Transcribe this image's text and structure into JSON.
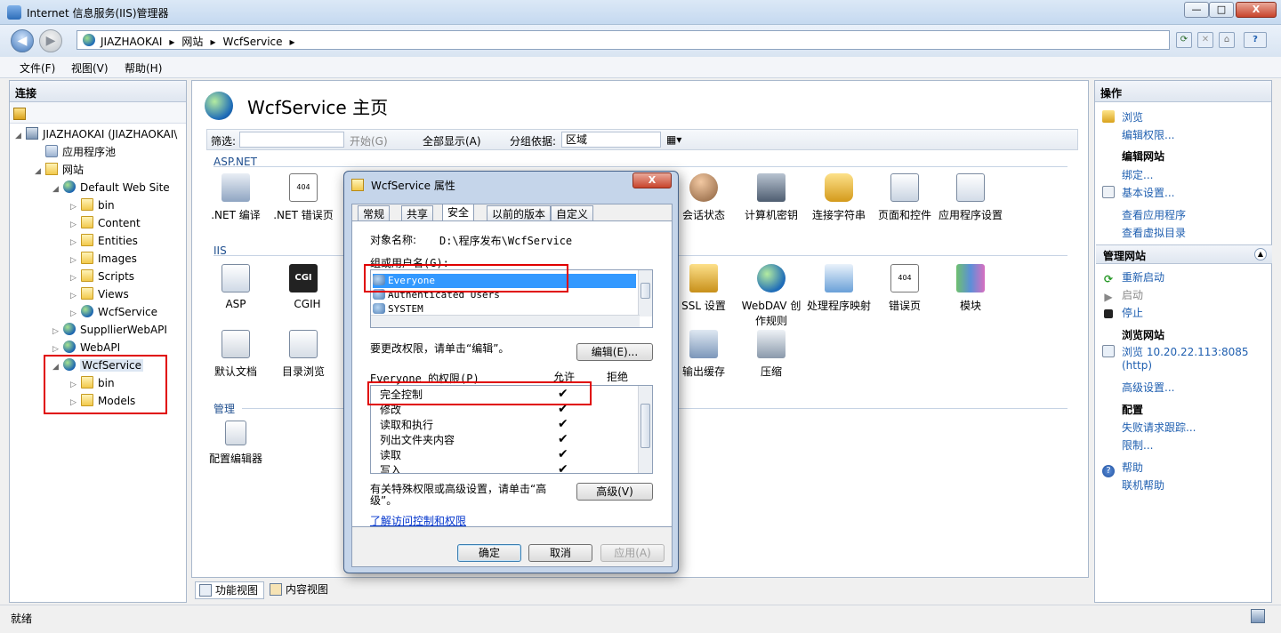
{
  "window": {
    "title": "Internet 信息服务(IIS)管理器",
    "minimize": "—",
    "maximize": "□",
    "close": "X"
  },
  "address": {
    "back": "◀",
    "forward": "▶",
    "crumbs": [
      "JIAZHAOKAI",
      "▸",
      "网站",
      "▸",
      "WcfService",
      "▸"
    ],
    "help": "?"
  },
  "menu": [
    "文件(F)",
    "视图(V)",
    "帮助(H)"
  ],
  "left_panel": {
    "header": "连接",
    "tree": [
      {
        "label": "JIAZHAOKAI (JIAZHAOKAI\\",
        "exp": "◢",
        "icon": "server-icon"
      },
      {
        "label": "应用程序池",
        "exp": "",
        "icon": "app-pool-icon"
      },
      {
        "label": "网站",
        "exp": "◢",
        "icon": "sites-folder-icon"
      },
      {
        "label": "Default Web Site",
        "exp": "◢",
        "icon": "globe-icon"
      },
      {
        "label": "bin",
        "exp": "▷",
        "icon": "folder-icon"
      },
      {
        "label": "Content",
        "exp": "▷",
        "icon": "folder-icon"
      },
      {
        "label": "Entities",
        "exp": "▷",
        "icon": "folder-icon"
      },
      {
        "label": "Images",
        "exp": "▷",
        "icon": "folder-icon"
      },
      {
        "label": "Scripts",
        "exp": "▷",
        "icon": "folder-icon"
      },
      {
        "label": "Views",
        "exp": "▷",
        "icon": "folder-icon"
      },
      {
        "label": "WcfService",
        "exp": "▷",
        "icon": "globe-icon"
      },
      {
        "label": "SuppllierWebAPI",
        "exp": "▷",
        "icon": "globe-icon"
      },
      {
        "label": "WebAPI",
        "exp": "▷",
        "icon": "globe-icon"
      },
      {
        "label": "WcfService",
        "exp": "◢",
        "icon": "globe-icon"
      },
      {
        "label": "bin",
        "exp": "▷",
        "icon": "folder-icon"
      },
      {
        "label": "Models",
        "exp": "▷",
        "icon": "folder-icon"
      }
    ]
  },
  "center": {
    "title": "WcfService 主页",
    "filter_label": "筛选:",
    "start": "开始(G)",
    "show_all": "全部显示(A)",
    "group_by": "分组依据:",
    "group_value": "区域",
    "sections": {
      "aspnet": "ASP.NET",
      "iis": "IIS",
      "manage": "管理"
    },
    "aspnet_features": [
      ".NET 编译",
      ".NET 错误页"
    ],
    "aspnet_features_right": [
      "会话状态",
      "计算机密钥",
      "连接字符串",
      "页面和控件",
      "应用程序设置"
    ],
    "iis_features": [
      "ASP",
      "CGI",
      "H"
    ],
    "iis_features_right": [
      "SSL 设置",
      "WebDAV 创作规则",
      "处理程序映射",
      "错误页",
      "模块"
    ],
    "iis_row2": [
      "默认文档",
      "目录浏览"
    ],
    "iis_row2_right": [
      "输出缓存",
      "压缩"
    ],
    "manage_features": [
      "配置编辑器"
    ],
    "cgi_text": "CGI",
    "err404": "404"
  },
  "bottom_tabs": [
    "功能视图",
    "内容视图"
  ],
  "right_panel": {
    "header": "操作",
    "browse": "浏览",
    "edit_perms": "编辑权限...",
    "edit_site": "编辑网站",
    "bindings": "绑定...",
    "basic": "基本设置...",
    "view_apps": "查看应用程序",
    "view_vdirs": "查看虚拟目录",
    "manage_site": "管理网站",
    "restart": "重新启动",
    "start": "启动",
    "stop": "停止",
    "browse_site": "浏览网站",
    "browse_url": "浏览 10.20.22.113:8085",
    "browse_proto": "(http)",
    "advanced": "高级设置...",
    "config": "配置",
    "failed_req": "失败请求跟踪...",
    "limits": "限制...",
    "help": "帮助",
    "online_help": "联机帮助"
  },
  "status": {
    "text": "就绪"
  },
  "dialog": {
    "title": "WcfService 属性",
    "close": "X",
    "tabs": [
      "常规",
      "共享",
      "安全",
      "以前的版本",
      "自定义"
    ],
    "object_label": "对象名称:",
    "object_value": "D:\\程序发布\\WcfService",
    "group_label": "组或用户名(G):",
    "users": [
      "Everyone",
      "Authenticated Users",
      "SYSTEM"
    ],
    "change_text": "要更改权限，请单击“编辑”。",
    "edit_btn": "编辑(E)...",
    "perm_label": "Everyone 的权限(P)",
    "allow": "允许",
    "deny": "拒绝",
    "permissions": [
      "完全控制",
      "修改",
      "读取和执行",
      "列出文件夹内容",
      "读取",
      "写入"
    ],
    "check": "✔",
    "special_text_1": "有关特殊权限或高级设置，请单击“高",
    "special_text_2": "级”。",
    "advanced_btn": "高级(V)",
    "learn_link": "了解访问控制和权限",
    "ok": "确定",
    "cancel": "取消",
    "apply": "应用(A)"
  }
}
